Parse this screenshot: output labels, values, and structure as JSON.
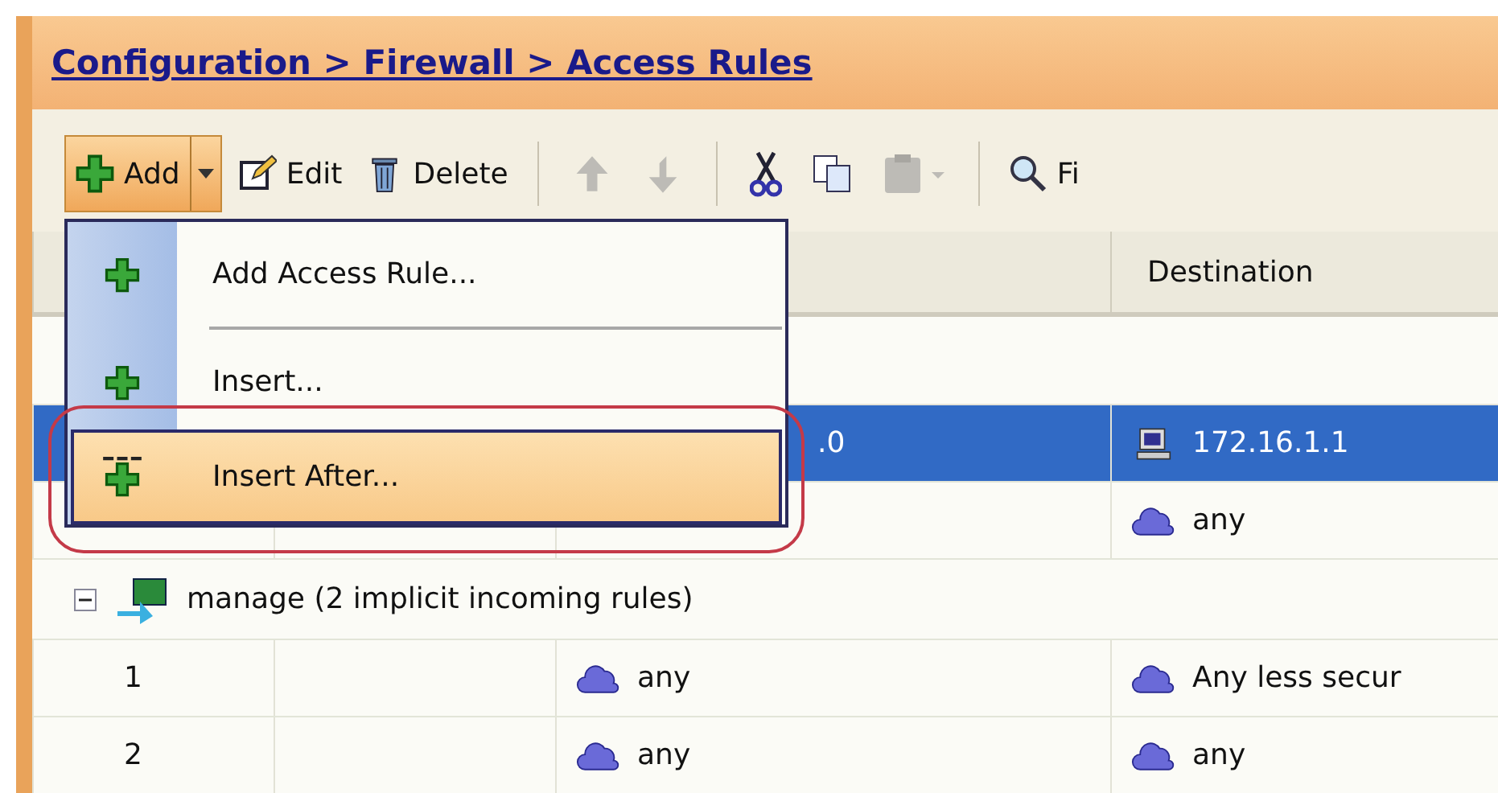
{
  "breadcrumb": {
    "title": "Configuration > Firewall > Access Rules"
  },
  "toolbar": [
    {
      "kind": "split",
      "label": "Add",
      "selected": true
    },
    {
      "kind": "button",
      "label": "Edit"
    },
    {
      "kind": "button",
      "label": "Delete"
    },
    {
      "kind": "separator"
    },
    {
      "kind": "icon",
      "disabled": true
    },
    {
      "kind": "icon",
      "disabled": true
    },
    {
      "kind": "separator"
    },
    {
      "kind": "icon",
      "disabled": false
    },
    {
      "kind": "icon",
      "disabled": false
    },
    {
      "kind": "icon",
      "disabled": true
    },
    {
      "kind": "separator"
    },
    {
      "kind": "button",
      "label": "Fi"
    }
  ],
  "menu": [
    {
      "kind": "item",
      "label": "Add Access Rule...",
      "selected": false
    },
    {
      "kind": "separator"
    },
    {
      "kind": "item",
      "label": "Insert...",
      "selected": false
    },
    {
      "kind": "item",
      "label": "Insert After...",
      "selected": true
    }
  ],
  "table": {
    "columns": [
      {},
      {},
      {},
      {
        "label": "Destination"
      }
    ],
    "rows": [
      {
        "kind": "rule",
        "selected": true,
        "source": {
          "text": ".0"
        },
        "destination": {
          "kind": "host",
          "text": "172.16.1.1"
        }
      },
      {
        "kind": "rule",
        "selected": false,
        "destination": {
          "kind": "network",
          "text": "any"
        }
      },
      {
        "kind": "group",
        "expanded": true,
        "label": "manage (2 implicit incoming rules)"
      },
      {
        "kind": "rule",
        "selected": false,
        "number": "1",
        "source": {
          "kind": "network",
          "text": "any"
        },
        "destination": {
          "kind": "network",
          "text": "Any less secur"
        }
      },
      {
        "kind": "rule",
        "selected": false,
        "number": "2",
        "source": {
          "kind": "network",
          "text": "any"
        },
        "destination": {
          "kind": "network",
          "text": "any"
        }
      }
    ]
  }
}
